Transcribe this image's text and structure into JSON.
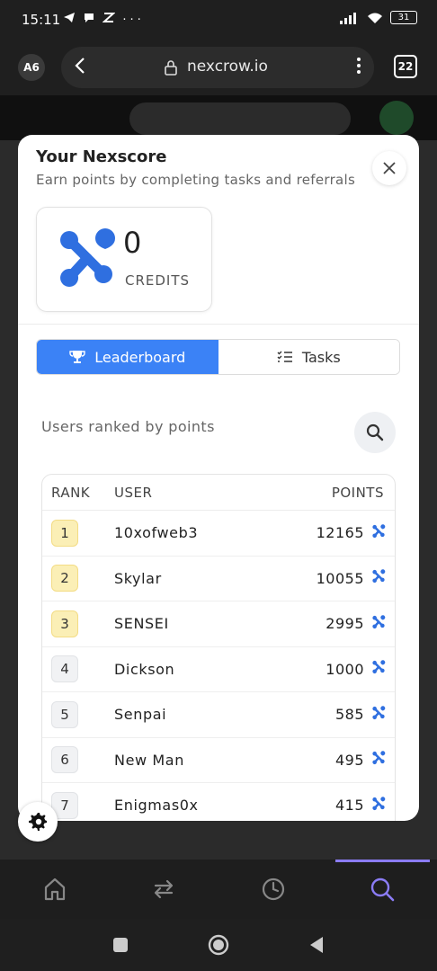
{
  "status_bar": {
    "time": "15:11",
    "left_icons": [
      "telegram-icon",
      "chat-icon",
      "app-icon",
      "more-dots"
    ],
    "more_dots": "···",
    "battery": "31"
  },
  "browser": {
    "profile": "A6",
    "url": "nexcrow.io",
    "tab_count": "22"
  },
  "modal": {
    "title": "Your Nexscore",
    "subtitle": "Earn points by completing tasks and referrals",
    "score": {
      "value": "0",
      "unit": "CREDITS"
    },
    "tabs": [
      {
        "label": "Leaderboard",
        "active": true
      },
      {
        "label": "Tasks",
        "active": false
      }
    ],
    "ranked_label": "Users ranked by points",
    "table": {
      "headers": {
        "rank": "RANK",
        "user": "USER",
        "points": "POINTS"
      },
      "rows": [
        {
          "rank": "1",
          "user": "10xofweb3",
          "points": "12165"
        },
        {
          "rank": "2",
          "user": "Skylar",
          "points": "10055"
        },
        {
          "rank": "3",
          "user": "SENSEI",
          "points": "2995"
        },
        {
          "rank": "4",
          "user": "Dickson",
          "points": "1000"
        },
        {
          "rank": "5",
          "user": "Senpai",
          "points": "585"
        },
        {
          "rank": "6",
          "user": "New Man",
          "points": "495"
        },
        {
          "rank": "7",
          "user": "Enigmas0x",
          "points": "415"
        }
      ]
    }
  },
  "bottom_nav": [
    "home-icon",
    "swap-icon",
    "history-icon",
    "search-icon"
  ],
  "colors": {
    "accent": "#3b82f6",
    "brand_logo": "#2f6fe0",
    "nav_active": "#8b7cf6",
    "top_rank_badge": "#fbefb6"
  }
}
